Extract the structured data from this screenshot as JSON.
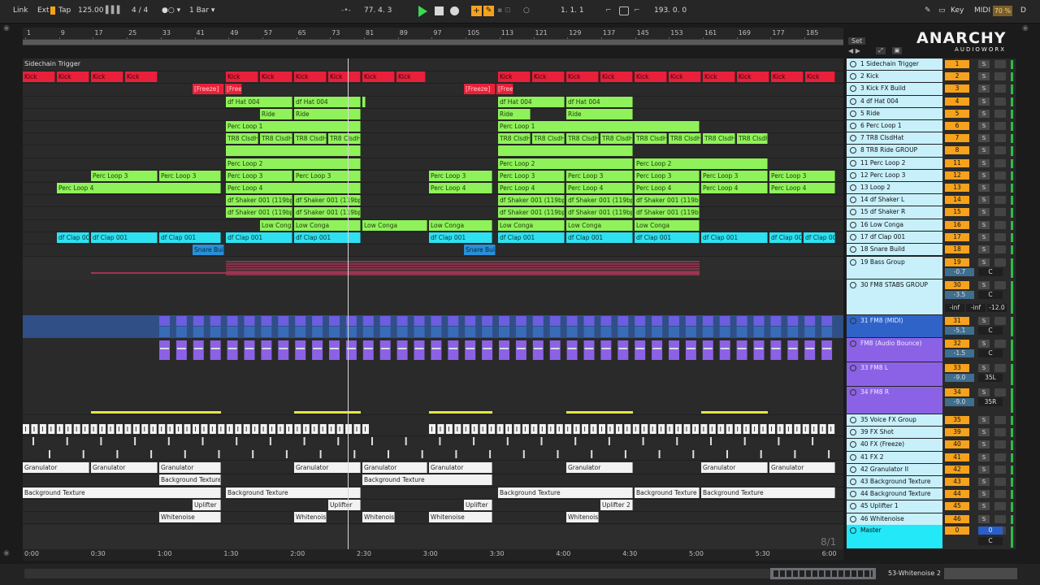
{
  "transport": {
    "link": "Link",
    "ext": "Ext",
    "tap": "Tap",
    "tempo": "125.00",
    "signature": "4 / 4",
    "quantize": "1 Bar ▾",
    "position": "77.  4.  3",
    "loop_start": "1.  1.  1",
    "loop_end": "193.  0.  0",
    "key": "Key",
    "midi": "MIDI",
    "cpu": "70 %",
    "d": "D"
  },
  "bar_numbers": [
    "1",
    "9",
    "17",
    "25",
    "33",
    "41",
    "49",
    "57",
    "65",
    "73",
    "81",
    "89",
    "97",
    "105",
    "113",
    "121",
    "129",
    "137",
    "145",
    "153",
    "161",
    "169",
    "177",
    "185"
  ],
  "time_labels": [
    "0:00",
    "0:30",
    "1:00",
    "1:30",
    "2:00",
    "2:30",
    "3:00",
    "3:30",
    "4:00",
    "4:30",
    "5:00",
    "5:30",
    "6:00"
  ],
  "set_label": "Set",
  "logo": {
    "main": "ANARCHY",
    "sub": "AUDIOWORX"
  },
  "zoom_label": "8/1",
  "status": {
    "track_name": "53-Whitenoise 2"
  },
  "lanes": [
    {
      "label": "Sidechain Trigger",
      "clips": []
    },
    {
      "clips": [
        {
          "t": "Kick",
          "c": "red",
          "s": 0,
          "e": 40
        },
        {
          "t": "Kick",
          "c": "red",
          "s": 42,
          "e": 82
        },
        {
          "t": "Kick",
          "c": "red",
          "s": 84,
          "e": 124
        },
        {
          "t": "Kick",
          "c": "red",
          "s": 126,
          "e": 166
        },
        {
          "t": "Kick",
          "c": "red",
          "s": 250,
          "e": 290
        },
        {
          "t": "Kick",
          "c": "red",
          "s": 292,
          "e": 332
        },
        {
          "t": "Kick",
          "c": "red",
          "s": 334,
          "e": 374
        },
        {
          "t": "Kick",
          "c": "red",
          "s": 376,
          "e": 416
        },
        {
          "t": "Kick",
          "c": "red",
          "s": 418,
          "e": 458
        },
        {
          "t": "Kick",
          "c": "red",
          "s": 460,
          "e": 496
        },
        {
          "t": "Kick",
          "c": "red",
          "s": 585,
          "e": 625
        },
        {
          "t": "Kick",
          "c": "red",
          "s": 627,
          "e": 667
        },
        {
          "t": "Kick",
          "c": "red",
          "s": 669,
          "e": 709
        },
        {
          "t": "Kick",
          "c": "red",
          "s": 711,
          "e": 751
        },
        {
          "t": "Kick",
          "c": "red",
          "s": 753,
          "e": 793
        },
        {
          "t": "Kick",
          "c": "red",
          "s": 795,
          "e": 835
        },
        {
          "t": "Kick",
          "c": "red",
          "s": 837,
          "e": 877
        },
        {
          "t": "Kick",
          "c": "red",
          "s": 879,
          "e": 919
        },
        {
          "t": "Kick",
          "c": "red",
          "s": 921,
          "e": 961
        },
        {
          "t": "Kick",
          "c": "red",
          "s": 963,
          "e": 1000
        }
      ]
    },
    {
      "clips": [
        {
          "t": "[Freeze]",
          "c": "frz",
          "s": 209,
          "e": 248
        },
        {
          "t": "[Free",
          "c": "frz",
          "s": 249,
          "e": 270
        },
        {
          "t": "[Freeze]",
          "c": "frz",
          "s": 543,
          "e": 582
        },
        {
          "t": "[Free",
          "c": "frz",
          "s": 583,
          "e": 604
        }
      ]
    },
    {
      "clips": [
        {
          "t": "df Hat 004",
          "c": "grn",
          "s": 250,
          "e": 332
        },
        {
          "t": "df Hat 004",
          "c": "grn",
          "s": 334,
          "e": 416
        },
        {
          "t": "",
          "c": "grn",
          "s": 418,
          "e": 416
        },
        {
          "t": "df Hat 004",
          "c": "grn",
          "s": 585,
          "e": 667
        },
        {
          "t": "df Hat 004",
          "c": "grn",
          "s": 669,
          "e": 751
        }
      ]
    },
    {
      "clips": [
        {
          "t": "Ride",
          "c": "grn",
          "s": 292,
          "e": 332
        },
        {
          "t": "Ride",
          "c": "grn",
          "s": 334,
          "e": 416
        },
        {
          "t": "Ride",
          "c": "grn",
          "s": 585,
          "e": 625
        },
        {
          "t": "Ride",
          "c": "grn",
          "s": 669,
          "e": 751
        }
      ]
    },
    {
      "clips": [
        {
          "t": "Perc Loop 1",
          "c": "grn",
          "s": 250,
          "e": 416
        },
        {
          "t": "Perc Loop 1",
          "c": "grn",
          "s": 585,
          "e": 833
        }
      ]
    },
    {
      "clips": [
        {
          "t": "TR8 ClsdH",
          "c": "grn",
          "s": 250,
          "e": 290
        },
        {
          "t": "TR8 ClsdH",
          "c": "grn",
          "s": 292,
          "e": 332
        },
        {
          "t": "TR8 ClsdH",
          "c": "grn",
          "s": 334,
          "e": 374
        },
        {
          "t": "TR8 ClsdH",
          "c": "grn",
          "s": 376,
          "e": 416
        },
        {
          "t": "TR8 ClsdH",
          "c": "grn",
          "s": 585,
          "e": 625
        },
        {
          "t": "TR8 ClsdH",
          "c": "grn",
          "s": 627,
          "e": 667
        },
        {
          "t": "TR8 ClsdH",
          "c": "grn",
          "s": 669,
          "e": 709
        },
        {
          "t": "TR8 ClsdH",
          "c": "grn",
          "s": 711,
          "e": 751
        },
        {
          "t": "TR8 ClsdH",
          "c": "grn",
          "s": 753,
          "e": 793
        },
        {
          "t": "TR8 ClsdH",
          "c": "grn",
          "s": 795,
          "e": 835
        },
        {
          "t": "TR8 ClsdH",
          "c": "grn",
          "s": 837,
          "e": 877
        },
        {
          "t": "TR8 ClsdH",
          "c": "grn",
          "s": 879,
          "e": 917
        }
      ]
    },
    {
      "clips": [
        {
          "t": "",
          "c": "grn",
          "s": 250,
          "e": 416
        },
        {
          "t": "",
          "c": "grn",
          "s": 585,
          "e": 751
        }
      ]
    },
    {
      "clips": [
        {
          "t": "Perc Loop 2",
          "c": "grn",
          "s": 250,
          "e": 416
        },
        {
          "t": "Perc Loop 2",
          "c": "grn",
          "s": 585,
          "e": 751
        },
        {
          "t": "Perc Loop 2",
          "c": "grn",
          "s": 753,
          "e": 917
        }
      ]
    },
    {
      "clips": [
        {
          "t": "Perc Loop 3",
          "c": "grn",
          "s": 84,
          "e": 166
        },
        {
          "t": "Perc Loop 3",
          "c": "grn",
          "s": 168,
          "e": 244
        },
        {
          "t": "Perc Loop 3",
          "c": "grn",
          "s": 250,
          "e": 332
        },
        {
          "t": "Perc Loop 3",
          "c": "grn",
          "s": 334,
          "e": 416
        },
        {
          "t": "Perc Loop 3",
          "c": "grn",
          "s": 500,
          "e": 578
        },
        {
          "t": "Perc Loop 3",
          "c": "grn",
          "s": 585,
          "e": 667
        },
        {
          "t": "Perc Loop 3",
          "c": "grn",
          "s": 669,
          "e": 751
        },
        {
          "t": "Perc Loop 3",
          "c": "grn",
          "s": 753,
          "e": 833
        },
        {
          "t": "Perc Loop 3",
          "c": "grn",
          "s": 835,
          "e": 917
        },
        {
          "t": "Perc Loop 3",
          "c": "grn",
          "s": 919,
          "e": 1000
        }
      ]
    },
    {
      "clips": [
        {
          "t": "Perc Loop 4",
          "c": "grn",
          "s": 42,
          "e": 244
        },
        {
          "t": "Perc Loop 4",
          "c": "grn",
          "s": 250,
          "e": 416
        },
        {
          "t": "Perc Loop 4",
          "c": "grn",
          "s": 500,
          "e": 578
        },
        {
          "t": "Perc Loop 4",
          "c": "grn",
          "s": 585,
          "e": 667
        },
        {
          "t": "Perc Loop 4",
          "c": "grn",
          "s": 669,
          "e": 751
        },
        {
          "t": "Perc Loop 4",
          "c": "grn",
          "s": 753,
          "e": 833
        },
        {
          "t": "Perc Loop 4",
          "c": "grn",
          "s": 835,
          "e": 917
        },
        {
          "t": "Perc Loop 4",
          "c": "grn",
          "s": 919,
          "e": 1000
        }
      ]
    },
    {
      "clips": [
        {
          "t": "df Shaker 001 (119bp",
          "c": "grn",
          "s": 250,
          "e": 332
        },
        {
          "t": "df Shaker 001 (119bp",
          "c": "grn",
          "s": 334,
          "e": 416
        },
        {
          "t": "df Shaker 001 (119bp",
          "c": "grn",
          "s": 585,
          "e": 667
        },
        {
          "t": "df Shaker 001 (119bp",
          "c": "grn",
          "s": 669,
          "e": 751
        },
        {
          "t": "df Shaker 001 (119bp",
          "c": "grn",
          "s": 753,
          "e": 833
        }
      ]
    },
    {
      "clips": [
        {
          "t": "df Shaker 001 (119bp",
          "c": "grn",
          "s": 250,
          "e": 332
        },
        {
          "t": "df Shaker 001 (119bp",
          "c": "grn",
          "s": 334,
          "e": 416
        },
        {
          "t": "df Shaker 001 (119bp",
          "c": "grn",
          "s": 585,
          "e": 667
        },
        {
          "t": "df Shaker 001 (119bp",
          "c": "grn",
          "s": 669,
          "e": 751
        },
        {
          "t": "df Shaker 001 (119bp",
          "c": "grn",
          "s": 753,
          "e": 833
        }
      ]
    },
    {
      "clips": [
        {
          "t": "Low Conga",
          "c": "grn",
          "s": 292,
          "e": 332
        },
        {
          "t": "Low Conga",
          "c": "grn",
          "s": 334,
          "e": 416
        },
        {
          "t": "Low Conga",
          "c": "grn",
          "s": 418,
          "e": 498
        },
        {
          "t": "Low Conga",
          "c": "grn",
          "s": 500,
          "e": 578
        },
        {
          "t": "Low Conga",
          "c": "grn",
          "s": 585,
          "e": 667
        },
        {
          "t": "Low Conga",
          "c": "grn",
          "s": 669,
          "e": 751
        },
        {
          "t": "Low Conga",
          "c": "grn",
          "s": 753,
          "e": 833
        }
      ]
    },
    {
      "clips": [
        {
          "t": "df Clap 00",
          "c": "cyn",
          "s": 42,
          "e": 82
        },
        {
          "t": "df Clap 001",
          "c": "cyn",
          "s": 84,
          "e": 166
        },
        {
          "t": "df Clap 001",
          "c": "cyn",
          "s": 168,
          "e": 244
        },
        {
          "t": "df Clap 001",
          "c": "cyn",
          "s": 250,
          "e": 332
        },
        {
          "t": "df Clap 001",
          "c": "cyn",
          "s": 334,
          "e": 416
        },
        {
          "t": "df Clap 001",
          "c": "cyn",
          "s": 500,
          "e": 578
        },
        {
          "t": "df Clap 001",
          "c": "cyn",
          "s": 585,
          "e": 667
        },
        {
          "t": "df Clap 001",
          "c": "cyn",
          "s": 669,
          "e": 751
        },
        {
          "t": "df Clap 001",
          "c": "cyn",
          "s": 753,
          "e": 833
        },
        {
          "t": "df Clap 001",
          "c": "cyn",
          "s": 835,
          "e": 917
        },
        {
          "t": "df Clap 00",
          "c": "cyn",
          "s": 919,
          "e": 959
        },
        {
          "t": "df Clap 00",
          "c": "cyn",
          "s": 961,
          "e": 1000
        }
      ]
    },
    {
      "clips": [
        {
          "t": "Snare Buil",
          "c": "blu",
          "s": 209,
          "e": 248
        },
        {
          "t": "Snare Buil",
          "c": "blu",
          "s": 543,
          "e": 582
        }
      ]
    }
  ],
  "bottom_lanes": [
    {
      "clips": [
        {
          "t": "Granulator",
          "c": "wht",
          "s": 0,
          "e": 82
        },
        {
          "t": "Granulator",
          "c": "wht",
          "s": 84,
          "e": 166
        },
        {
          "t": "Granulator",
          "c": "wht",
          "s": 168,
          "e": 244
        },
        {
          "t": "Granulator",
          "c": "wht",
          "s": 334,
          "e": 416
        },
        {
          "t": "Granulator",
          "c": "wht",
          "s": 418,
          "e": 498
        },
        {
          "t": "Granulator",
          "c": "wht",
          "s": 500,
          "e": 578
        },
        {
          "t": "Granulator",
          "c": "wht",
          "s": 669,
          "e": 751
        },
        {
          "t": "Granulator",
          "c": "wht",
          "s": 835,
          "e": 917
        },
        {
          "t": "Granulator",
          "c": "wht",
          "s": 919,
          "e": 1000
        }
      ]
    },
    {
      "clips": [
        {
          "t": "Background Texture",
          "c": "wht",
          "s": 168,
          "e": 244
        },
        {
          "t": "Background Texture",
          "c": "wht",
          "s": 418,
          "e": 578
        }
      ]
    },
    {
      "clips": [
        {
          "t": "Background Texture",
          "c": "wht",
          "s": 0,
          "e": 244
        },
        {
          "t": "Background Texture",
          "c": "wht",
          "s": 250,
          "e": 416
        },
        {
          "t": "Background Texture",
          "c": "wht",
          "s": 585,
          "e": 751
        },
        {
          "t": "Background Texture",
          "c": "wht",
          "s": 753,
          "e": 833
        },
        {
          "t": "Background Texture",
          "c": "wht",
          "s": 835,
          "e": 1000
        }
      ]
    },
    {
      "clips": [
        {
          "t": "Uplifter",
          "c": "wht",
          "s": 209,
          "e": 244
        },
        {
          "t": "Uplifter",
          "c": "wht",
          "s": 376,
          "e": 416
        },
        {
          "t": "Uplifter",
          "c": "wht",
          "s": 543,
          "e": 578
        },
        {
          "t": "Uplifter 2",
          "c": "wht",
          "s": 711,
          "e": 751
        }
      ]
    },
    {
      "clips": [
        {
          "t": "Whitenoise",
          "c": "wht",
          "s": 168,
          "e": 244
        },
        {
          "t": "Whitenois",
          "c": "wht",
          "s": 334,
          "e": 374
        },
        {
          "t": "Whitenois",
          "c": "wht",
          "s": 418,
          "e": 458
        },
        {
          "t": "Whitenoise",
          "c": "wht",
          "s": 500,
          "e": 578
        },
        {
          "t": "Whitenois",
          "c": "wht",
          "s": 669,
          "e": 709
        }
      ]
    }
  ],
  "tracks": [
    {
      "name": "1 Sidechain Trigger",
      "num": "1",
      "color": "#c7f0fb"
    },
    {
      "name": "2 Kick",
      "num": "2",
      "color": "#c7f0fb"
    },
    {
      "name": "3 Kick FX Build",
      "num": "3",
      "color": "#c7f0fb"
    },
    {
      "name": "4 df Hat 004",
      "num": "4",
      "color": "#c7f0fb"
    },
    {
      "name": "5 Ride",
      "num": "5",
      "color": "#c7f0fb"
    },
    {
      "name": "6 Perc Loop 1",
      "num": "6",
      "color": "#c7f0fb"
    },
    {
      "name": "7 TR8 ClsdHat",
      "num": "7",
      "color": "#c7f0fb"
    },
    {
      "name": "8 TR8 Ride GROUP",
      "num": "8",
      "color": "#c7f0fb"
    },
    {
      "name": "11 Perc Loop 2",
      "num": "11",
      "color": "#c7f0fb"
    },
    {
      "name": "12 Perc Loop 3",
      "num": "12",
      "color": "#c7f0fb"
    },
    {
      "name": "13 Loop 2",
      "num": "13",
      "color": "#c7f0fb"
    },
    {
      "name": "14 df Shaker L",
      "num": "14",
      "color": "#c7f0fb"
    },
    {
      "name": "15 df Shaker R",
      "num": "15",
      "color": "#c7f0fb"
    },
    {
      "name": "16 Low Conga",
      "num": "16",
      "color": "#c7f0fb"
    },
    {
      "name": "17 df Clap 001",
      "num": "17",
      "color": "#c7f0fb"
    },
    {
      "name": "18 Snare Build",
      "num": "18",
      "color": "#c7f0fb"
    }
  ],
  "group_tracks": [
    {
      "name": "19 Bass Group",
      "num": "19",
      "vol": "-0.7",
      "pan": "C"
    },
    {
      "name": "30 FM8 STABS GROUP",
      "num": "30",
      "vol": "-3.5",
      "pan": "C",
      "extra": [
        "-inf",
        "-inf",
        "-12.0"
      ]
    },
    {
      "name": "31 FM8 (MIDI)",
      "num": "31",
      "vol": "-5.1",
      "pan": "C"
    },
    {
      "name": "FM8 (Audio Bounce)",
      "num": "32",
      "vol": "-1.5",
      "pan": "C"
    },
    {
      "name": "33 FM8 L",
      "num": "33",
      "vol": "-9.0",
      "pan": "35L"
    },
    {
      "name": "34 FM8 R",
      "num": "34",
      "vol": "-9.0",
      "pan": "35R"
    }
  ],
  "tail_tracks": [
    {
      "name": "35 Voice FX Group",
      "num": "35"
    },
    {
      "name": "39 FX Shot",
      "num": "39"
    },
    {
      "name": "40 FX (Freeze)",
      "num": "40"
    },
    {
      "name": "41 FX 2",
      "num": "41"
    },
    {
      "name": "42 Granulator II",
      "num": "42"
    },
    {
      "name": "43 Background Texture",
      "num": "43"
    },
    {
      "name": "44 Background Texture",
      "num": "44"
    },
    {
      "name": "45 Uplifter 1",
      "num": "45"
    },
    {
      "name": "46 Whitenoise",
      "num": "46"
    }
  ],
  "master": {
    "name": "Master",
    "num": "0",
    "send": "0",
    "pan": "C"
  },
  "solo_label": "S"
}
